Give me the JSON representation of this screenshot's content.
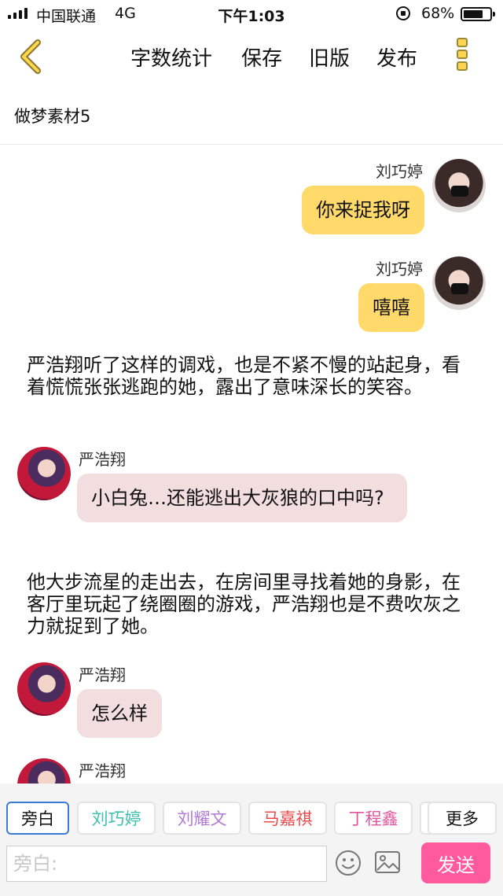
{
  "status_bar": {
    "carrier": "中国联通",
    "network": "4G",
    "time": "下午1:03",
    "battery": "68%",
    "battery_level": 0.68
  },
  "toolbar": {
    "word_count_label": "字数统计",
    "save_label": "保存",
    "old_version_label": "旧版",
    "publish_label": "发布",
    "back_icon": "chevron-left-icon",
    "more_icon": "vertical-dots-icon",
    "accent_color": "#ffd54f"
  },
  "document": {
    "title": "做梦素材5"
  },
  "messages": [
    {
      "type": "bubble",
      "side": "right",
      "sender": "刘巧婷",
      "text": "你来捉我呀"
    },
    {
      "type": "bubble",
      "side": "right",
      "sender": "刘巧婷",
      "text": "嘻嘻"
    },
    {
      "type": "narration",
      "text": "严浩翔听了这样的调戏，也是不紧不慢的站起身，看着慌慌张张逃跑的她，露出了意味深长的笑容。"
    },
    {
      "type": "bubble",
      "side": "left",
      "sender": "严浩翔",
      "text": "小白兔…还能逃出大灰狼的口中吗?"
    },
    {
      "type": "narration",
      "text": "他大步流星的走出去，在房间里寻找着她的身影，在客厅里玩起了绕圈圈的游戏，严浩翔也是不费吹灰之力就捉到了她。"
    },
    {
      "type": "bubble",
      "side": "left",
      "sender": "严浩翔",
      "text": "怎么样"
    },
    {
      "type": "bubble",
      "side": "left",
      "sender": "严浩翔",
      "text": ""
    }
  ],
  "characters": [
    {
      "label": "旁白",
      "color": "#111111",
      "active": true
    },
    {
      "label": "刘巧婷",
      "color": "#3cbfae",
      "active": false
    },
    {
      "label": "刘耀文",
      "color": "#b07ad6",
      "active": false
    },
    {
      "label": "马嘉祺",
      "color": "#e84a4a",
      "active": false
    },
    {
      "label": "丁程鑫",
      "color": "#e0569a",
      "active": false
    },
    {
      "label": "",
      "color": "#111111",
      "active": false
    },
    {
      "label": "更多",
      "color": "#111111",
      "active": false
    }
  ],
  "input": {
    "placeholder": "旁白:",
    "value": "",
    "emoji_icon": "smiley-icon",
    "image_icon": "image-icon",
    "send_label": "发送",
    "send_color": "#ff5a9e"
  },
  "colors": {
    "right_bubble": "#ffd96a",
    "left_bubble": "#f2dede"
  }
}
